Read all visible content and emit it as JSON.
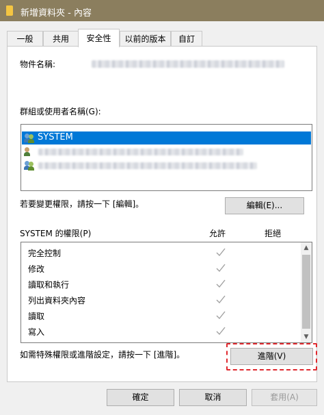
{
  "window": {
    "title": "新增資料夾 - 內容"
  },
  "tabs": [
    {
      "label": "一般"
    },
    {
      "label": "共用"
    },
    {
      "label": "安全性"
    },
    {
      "label": "以前的版本"
    },
    {
      "label": "自訂"
    }
  ],
  "security": {
    "object_name_label": "物件名稱:",
    "group_label": "群組或使用者名稱(G):",
    "users": [
      {
        "name": "SYSTEM",
        "selected": true,
        "icon": "users-group-icon"
      },
      {
        "name": "",
        "selected": false,
        "icon": "user-admin-icon"
      },
      {
        "name": "",
        "selected": false,
        "icon": "users-group-icon"
      }
    ],
    "edit_hint": "若要變更權限，請按一下 [編輯]。",
    "edit_button": "編輯(E)...",
    "perm_header": "SYSTEM 的權限(P)",
    "allow_label": "允許",
    "deny_label": "拒絕",
    "permissions": [
      {
        "name": "完全控制",
        "allow": true,
        "deny": false
      },
      {
        "name": "修改",
        "allow": true,
        "deny": false
      },
      {
        "name": "讀取和執行",
        "allow": true,
        "deny": false
      },
      {
        "name": "列出資料夾內容",
        "allow": true,
        "deny": false
      },
      {
        "name": "讀取",
        "allow": true,
        "deny": false
      },
      {
        "name": "寫入",
        "allow": true,
        "deny": false
      }
    ],
    "advanced_hint": "如需特殊權限或進階設定，請按一下 [進階]。",
    "advanced_button": "進階(V)"
  },
  "footer": {
    "ok": "確定",
    "cancel": "取消",
    "apply": "套用(A)"
  },
  "colors": {
    "titlebar": "#8b7e5e",
    "selection": "#0078d7",
    "highlight": "#e0282e"
  }
}
